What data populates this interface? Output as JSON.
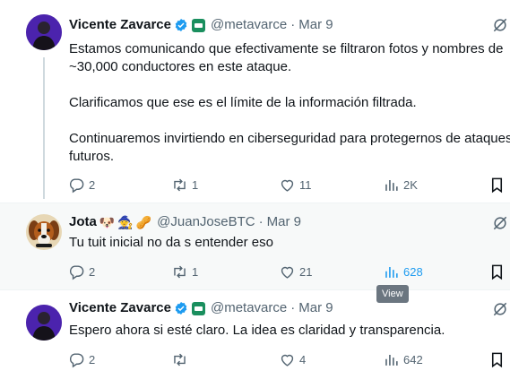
{
  "tweets": [
    {
      "author": {
        "name": "Vicente Zavarce",
        "handle": "@metavarce",
        "verified": true,
        "affiliate_badge": true
      },
      "date": "Mar 9",
      "text_lines": [
        "Estamos comunicando que efectivamente se filtraron fotos y nombres de",
        "~30,000 conductores en este ataque.",
        "",
        "Clarificamos que ese es el límite de la información filtrada.",
        "",
        "Continuaremos invirtiendo en ciberseguridad para protegernos de ataques",
        "futuros."
      ],
      "stats": {
        "replies": "2",
        "reposts": "1",
        "likes": "11",
        "views": "2K"
      }
    },
    {
      "author": {
        "name": "Jota",
        "handle": "@JuanJoseBTC",
        "name_emojis": [
          "dog-face",
          "wizard",
          "peanut"
        ]
      },
      "date": "Mar 9",
      "text_lines": [
        "Tu tuit inicial no da s entender eso"
      ],
      "stats": {
        "replies": "2",
        "reposts": "1",
        "likes": "21",
        "views": "628"
      }
    },
    {
      "author": {
        "name": "Vicente Zavarce",
        "handle": "@metavarce",
        "verified": true,
        "affiliate_badge": true
      },
      "date": "Mar 9",
      "text_lines": [
        "Espero ahora si esté claro. La idea es claridad y transparencia."
      ],
      "stats": {
        "replies": "2",
        "reposts": "",
        "likes": "4",
        "views": "642"
      }
    }
  ],
  "tooltip": {
    "text": "View"
  },
  "colors": {
    "accent": "#1d9bf0",
    "muted": "#536471",
    "text": "#0f1419",
    "tooltip_bg": "#6b7680",
    "hover_row_bg": "#f7f9f9"
  },
  "icons": {
    "reply": "reply-icon",
    "repost": "repost-icon",
    "like": "heart-icon",
    "views": "views-icon",
    "bookmark": "bookmark-icon",
    "grok": "grok-icon",
    "verified": "verified-badge-icon",
    "affiliate": "affiliate-badge-icon"
  }
}
